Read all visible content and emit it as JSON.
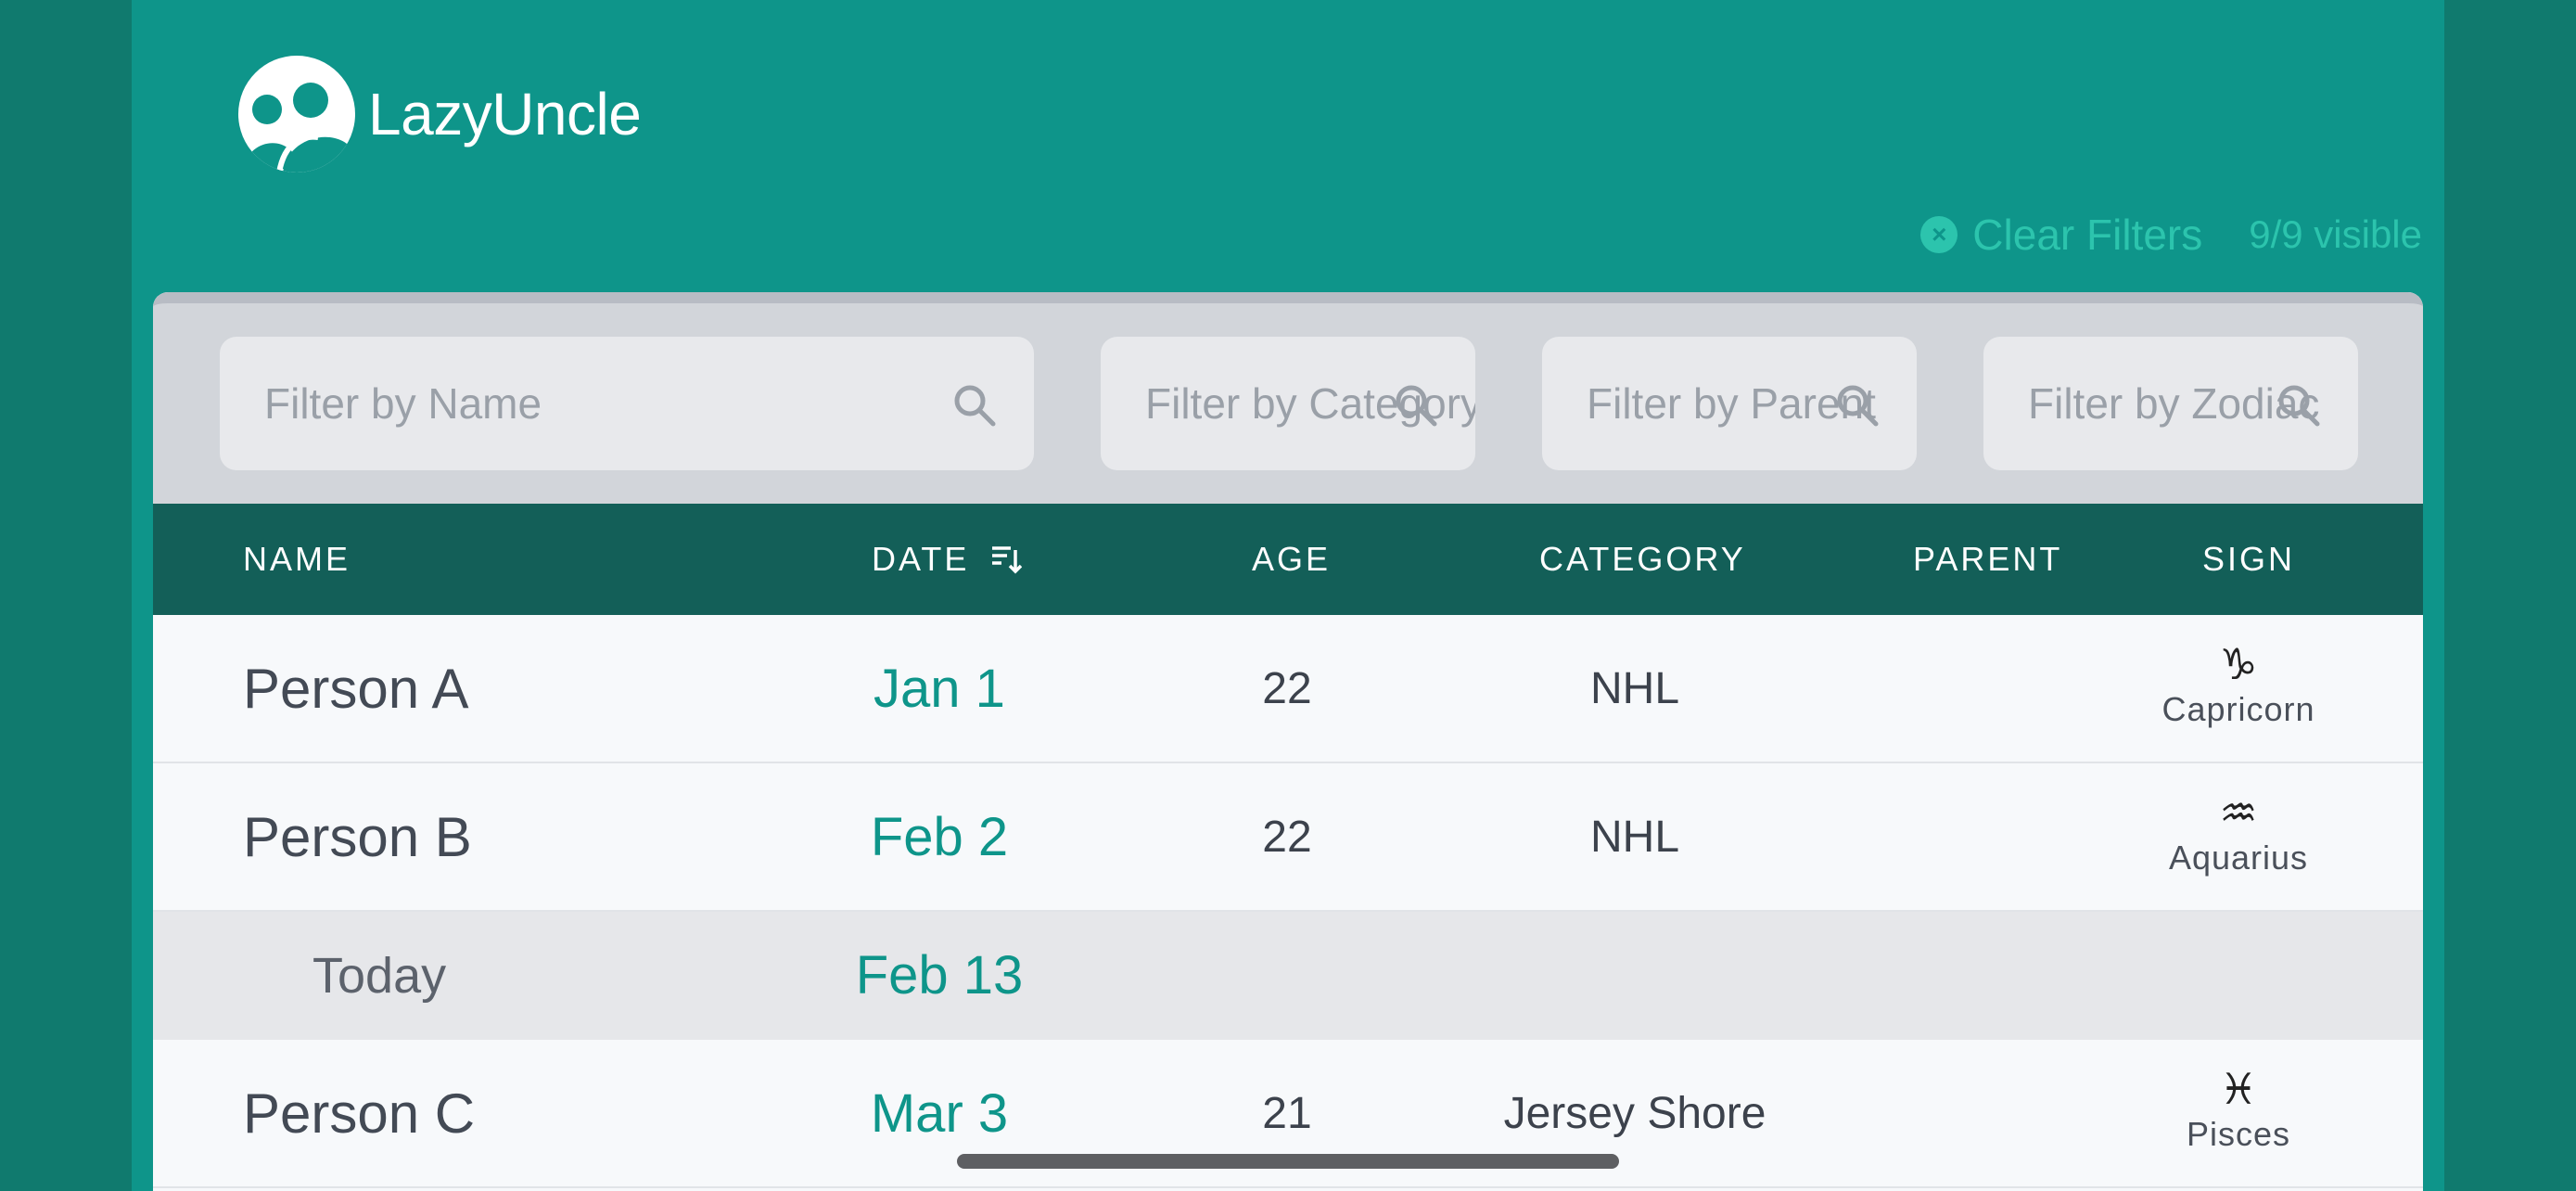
{
  "app": {
    "name": "LazyUncle"
  },
  "toolbar": {
    "clear_filters": "Clear Filters",
    "visible_count": "9/9 visible"
  },
  "filters": {
    "name_placeholder": "Filter by Name",
    "category_placeholder": "Filter by Category",
    "parent_placeholder": "Filter by Parent",
    "zodiac_placeholder": "Filter by Zodiac"
  },
  "columns": {
    "name": "NAME",
    "date": "DATE",
    "age": "AGE",
    "category": "CATEGORY",
    "parent": "PARENT",
    "sign": "SIGN"
  },
  "rows": [
    {
      "name": "Person A",
      "date": "Jan 1",
      "age": "22",
      "category": "NHL",
      "parent": "",
      "sign_glyph": "♑",
      "sign": "Capricorn"
    },
    {
      "name": "Person B",
      "date": "Feb 2",
      "age": "22",
      "category": "NHL",
      "parent": "",
      "sign_glyph": "♒",
      "sign": "Aquarius"
    },
    {
      "name": "Person C",
      "date": "Mar 3",
      "age": "21",
      "category": "Jersey Shore",
      "parent": "",
      "sign_glyph": "♓",
      "sign": "Pisces"
    }
  ],
  "today": {
    "label": "Today",
    "date": "Feb 13"
  },
  "icons": {
    "logo": "people-icon",
    "clear": "clear-circle-icon",
    "search": "search-icon",
    "sort": "sort-descending-icon"
  },
  "colors": {
    "app_bg": "#0e958a",
    "accent": "#2cc4ad",
    "header": "#135f58"
  }
}
